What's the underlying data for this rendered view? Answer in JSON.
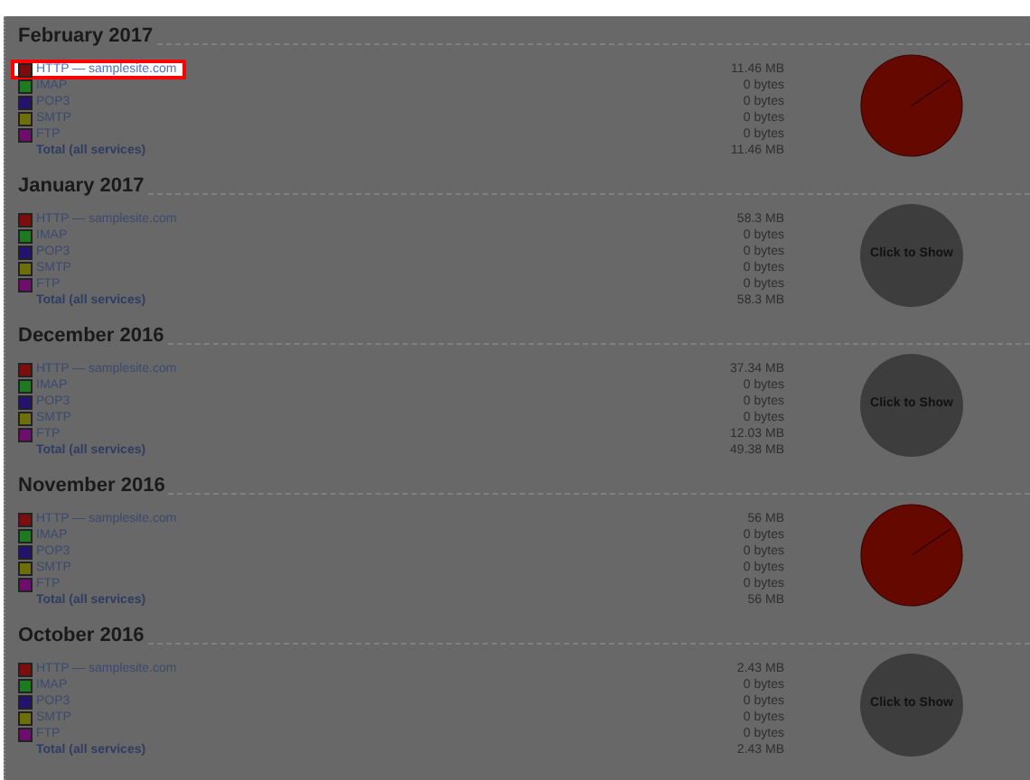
{
  "months": [
    {
      "title": "February 2017",
      "services": [
        {
          "label": "HTTP — samplesite.com",
          "value": "11.46 MB",
          "color": "#7d0c0c",
          "selected": true
        },
        {
          "label": "IMAP",
          "value": "0 bytes",
          "color": "#1e7a1e",
          "selected": false
        },
        {
          "label": "POP3",
          "value": "0 bytes",
          "color": "#23126e",
          "selected": false
        },
        {
          "label": "SMTP",
          "value": "0 bytes",
          "color": "#6e6e0a",
          "selected": false
        },
        {
          "label": "FTP",
          "value": "0 bytes",
          "color": "#6e0d6e",
          "selected": false
        }
      ],
      "total": {
        "label": "Total (all services)",
        "value": "11.46 MB"
      },
      "chart": {
        "kind": "pie"
      }
    },
    {
      "title": "January 2017",
      "services": [
        {
          "label": "HTTP — samplesite.com",
          "value": "58.3 MB",
          "color": "#7d0c0c",
          "selected": false
        },
        {
          "label": "IMAP",
          "value": "0 bytes",
          "color": "#1e7a1e",
          "selected": false
        },
        {
          "label": "POP3",
          "value": "0 bytes",
          "color": "#23126e",
          "selected": false
        },
        {
          "label": "SMTP",
          "value": "0 bytes",
          "color": "#6e6e0a",
          "selected": false
        },
        {
          "label": "FTP",
          "value": "0 bytes",
          "color": "#6e0d6e",
          "selected": false
        }
      ],
      "total": {
        "label": "Total (all services)",
        "value": "58.3 MB"
      },
      "chart": {
        "kind": "button",
        "label": "Click to Show"
      }
    },
    {
      "title": "December 2016",
      "services": [
        {
          "label": "HTTP — samplesite.com",
          "value": "37.34 MB",
          "color": "#7d0c0c",
          "selected": false
        },
        {
          "label": "IMAP",
          "value": "0 bytes",
          "color": "#1e7a1e",
          "selected": false
        },
        {
          "label": "POP3",
          "value": "0 bytes",
          "color": "#23126e",
          "selected": false
        },
        {
          "label": "SMTP",
          "value": "0 bytes",
          "color": "#6e6e0a",
          "selected": false
        },
        {
          "label": "FTP",
          "value": "12.03 MB",
          "color": "#6e0d6e",
          "selected": false
        }
      ],
      "total": {
        "label": "Total (all services)",
        "value": "49.38 MB"
      },
      "chart": {
        "kind": "button",
        "label": "Click to Show"
      }
    },
    {
      "title": "November 2016",
      "services": [
        {
          "label": "HTTP — samplesite.com",
          "value": "56 MB",
          "color": "#7d0c0c",
          "selected": false
        },
        {
          "label": "IMAP",
          "value": "0 bytes",
          "color": "#1e7a1e",
          "selected": false
        },
        {
          "label": "POP3",
          "value": "0 bytes",
          "color": "#23126e",
          "selected": false
        },
        {
          "label": "SMTP",
          "value": "0 bytes",
          "color": "#6e6e0a",
          "selected": false
        },
        {
          "label": "FTP",
          "value": "0 bytes",
          "color": "#6e0d6e",
          "selected": false
        }
      ],
      "total": {
        "label": "Total (all services)",
        "value": "56 MB"
      },
      "chart": {
        "kind": "pie"
      }
    },
    {
      "title": "October 2016",
      "services": [
        {
          "label": "HTTP — samplesite.com",
          "value": "2.43 MB",
          "color": "#7d0c0c",
          "selected": false
        },
        {
          "label": "IMAP",
          "value": "0 bytes",
          "color": "#1e7a1e",
          "selected": false
        },
        {
          "label": "POP3",
          "value": "0 bytes",
          "color": "#23126e",
          "selected": false
        },
        {
          "label": "SMTP",
          "value": "0 bytes",
          "color": "#6e6e0a",
          "selected": false
        },
        {
          "label": "FTP",
          "value": "0 bytes",
          "color": "#6e0d6e",
          "selected": false
        }
      ],
      "total": {
        "label": "Total (all services)",
        "value": "2.43 MB"
      },
      "chart": {
        "kind": "button",
        "label": "Click to Show"
      }
    }
  ]
}
